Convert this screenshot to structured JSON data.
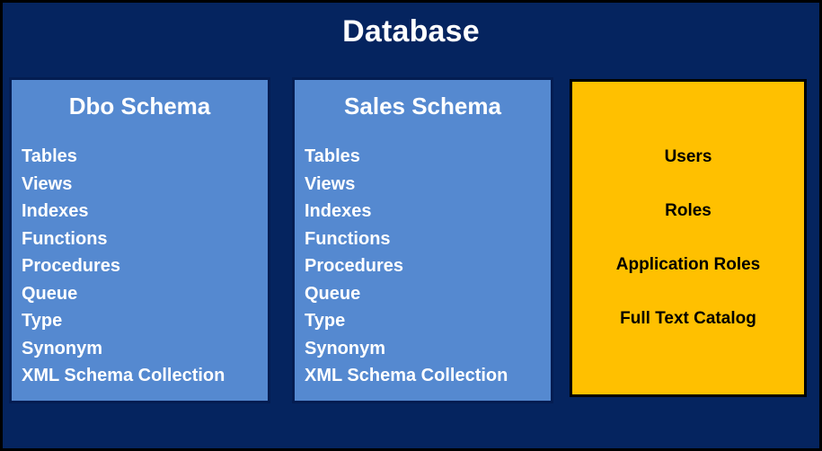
{
  "diagram": {
    "title": "Database",
    "colors": {
      "background": "#05245f",
      "schema_fill": "#5589d0",
      "schema_border": "#041d52",
      "security_fill": "#ffc000",
      "security_border": "#000000",
      "title_text": "#ffffff",
      "schema_text": "#ffffff",
      "security_text": "#000000",
      "frame_border": "#000000"
    },
    "schemas": [
      {
        "title": "Dbo Schema",
        "objects": [
          "Tables",
          "Views",
          "Indexes",
          "Functions",
          "Procedures",
          "Queue",
          "Type",
          "Synonym",
          "XML Schema Collection"
        ]
      },
      {
        "title": "Sales Schema",
        "objects": [
          "Tables",
          "Views",
          "Indexes",
          "Functions",
          "Procedures",
          "Queue",
          "Type",
          "Synonym",
          "XML Schema Collection"
        ]
      }
    ],
    "security": {
      "items": [
        "Users",
        "Roles",
        "Application Roles",
        "Full Text Catalog"
      ]
    }
  }
}
